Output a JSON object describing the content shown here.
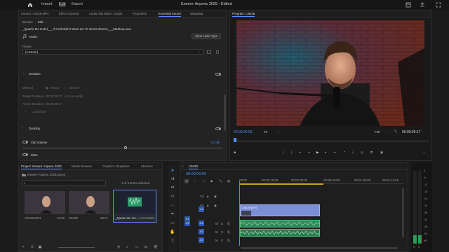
{
  "app": {
    "menu": [
      "Import",
      "Edit",
      "Export"
    ],
    "active_menu": "Edit",
    "project_title": "Клиент Апрель 2025 - Edited"
  },
  "source_panel": {
    "tabs": [
      "Source: C8428.MP4",
      "Effect Controls",
      "Audio Clip Mixer: C8428",
      "Properties",
      "Essential Sound",
      "Metadata"
    ],
    "active_tab": "Essential Sound",
    "subtabs": [
      "Browse",
      "Edit"
    ],
    "active_subtab": "Edit",
    "clip_name": "_Quarto De Hotel___If God Didn't Want Us To Snort Worms___Mashup.wav",
    "type_label": "Music",
    "clear_button": "Clear Audio Type",
    "preset_label": "Preset",
    "preset_value": "(Custom)",
    "duration_header": "Duration",
    "method_label": "Method",
    "method_options": [
      "Remix",
      "Stretch"
    ],
    "target_duration_label": "Target Duration",
    "target_duration_value": "00:00:39:17",
    "target_duration_note": "(16 seconds)",
    "remix_duration_label": "Remix Duration",
    "remix_duration_value": "00:00:39:17",
    "customize_label": "Customize",
    "ducking_label": "Ducking",
    "clip_volume_label": "Clip Volume",
    "clip_volume_value": "0.0 db",
    "mute_label": "Mute"
  },
  "program_panel": {
    "title": "Program: C8428",
    "timecode": "00:00:00:00",
    "fit": "Fit",
    "quality": "Full",
    "duration": "00:00:39:17"
  },
  "project_panel": {
    "tabs": [
      "Project: Клиент Апрель 2025",
      "Media Browser",
      "Graphics Templates",
      "Libraries"
    ],
    "active_tab": "Project: Клиент Апрель 2025",
    "file_name": "Клиент Апрель 2025.prproj",
    "selection_info": "1 of 3 items selected",
    "items": [
      {
        "name": "C8428.MP4",
        "duration": "49:22"
      },
      {
        "name": "C8428",
        "duration": "39:17"
      },
      {
        "name": "_Quarto De Ho...",
        "duration": "2:43:10420"
      }
    ]
  },
  "timeline": {
    "sequence": "C8428",
    "timecode": "00:00:00:00",
    "ruler": [
      "00:00",
      "00:00:15:00",
      "00:00:30:00",
      "00:00:45:00",
      "00:01:00:00",
      "00:01:15:00",
      "00:01:30:00"
    ],
    "video_tracks": [
      "V3",
      "V2",
      "V1"
    ],
    "audio_tracks": [
      "A1",
      "A2",
      "A3"
    ],
    "targets": [
      "V1",
      "A1"
    ],
    "track_buttons": [
      "M",
      "S"
    ],
    "video_clip_label": "C8428.MP4"
  },
  "meter": {
    "scale": [
      "0",
      "-6",
      "-12",
      "-18",
      "-24",
      "-30",
      "-36",
      "-42",
      "-48",
      "-54",
      "dB"
    ],
    "solo_labels": [
      "S",
      "S"
    ]
  },
  "colors": {
    "accent": "#4f8ef7",
    "video_clip": "#7b8fd6",
    "audio_clip": "#2f8a5a",
    "timecode": "#4f8ef7"
  }
}
